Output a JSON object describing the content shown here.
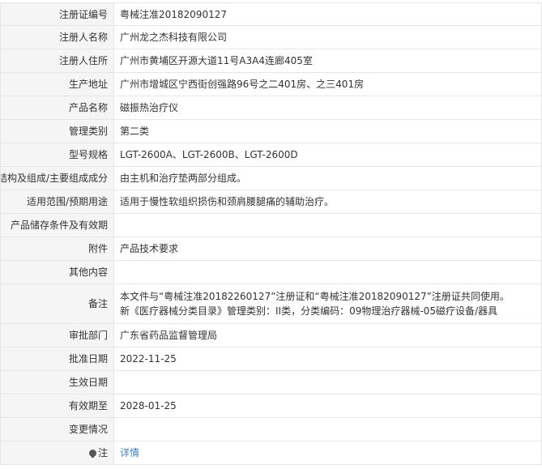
{
  "rows": [
    {
      "label": "注册证编号",
      "value": "粤械注准20182090127"
    },
    {
      "label": "注册人名称",
      "value": "广州龙之杰科技有限公司"
    },
    {
      "label": "注册人住所",
      "value": "广州市黄埔区开源大道11号A3A4连廊405室"
    },
    {
      "label": "生产地址",
      "value": "广州市增城区宁西街创强路96号之二401房、之三401房"
    },
    {
      "label": "产品名称",
      "value": "磁振热治疗仪"
    },
    {
      "label": "管理类别",
      "value": "第二类"
    },
    {
      "label": "型号规格",
      "value": "LGT-2600A、LGT-2600B、LGT-2600D"
    },
    {
      "label": "结构及组成/主要组成成分",
      "value": "由主机和治疗垫两部分组成。"
    },
    {
      "label": "适用范围/预期用途",
      "value": "适用于慢性软组织损伤和颈肩腰腿痛的辅助治疗。"
    },
    {
      "label": "产品储存条件及有效期",
      "value": ""
    },
    {
      "label": "附件",
      "value": "产品技术要求"
    },
    {
      "label": "其他内容",
      "value": ""
    },
    {
      "label": "备注",
      "value_lines": [
        "本文件与“粤械注准20182260127”注册证和“粤械注准20182090127”注册证共同使用。",
        "新《医疗器械分类目录》管理类别：II类，分类编码：09物理治疗器械-05磁疗设备/器具"
      ]
    },
    {
      "label": "审批部门",
      "value": "广东省药品监督管理局"
    },
    {
      "label": "批准日期",
      "value": "2022-11-25"
    },
    {
      "label": "生效日期",
      "value": ""
    },
    {
      "label": "有效期至",
      "value": "2028-01-25"
    },
    {
      "label": "变更情况",
      "value": ""
    }
  ],
  "footer": {
    "icon": "lightbulb-icon",
    "label": "注",
    "link_text": "详情"
  },
  "colors": {
    "label_bg": "#f5f5f5",
    "border": "#e6e6e6",
    "link": "#3f7fc1"
  }
}
